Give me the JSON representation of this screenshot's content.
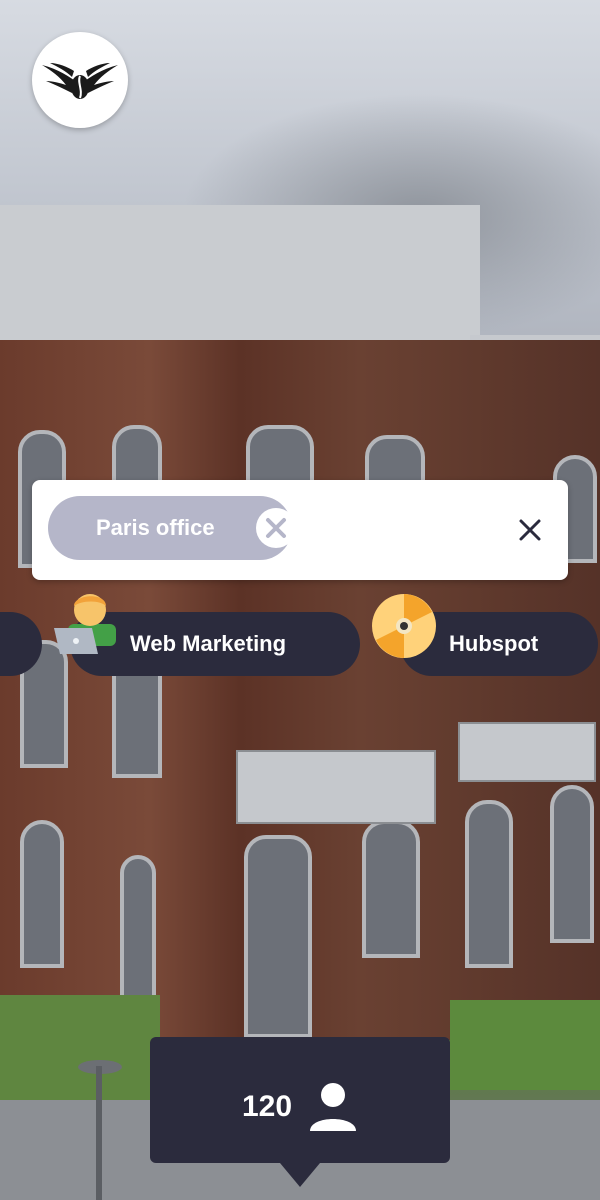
{
  "background": {
    "description_icon": "building-photo"
  },
  "logo": {
    "icon": "winged-coffee-bean-icon"
  },
  "filter": {
    "chip_label": "Paris office",
    "chip_remove_icon": "close-circle-icon",
    "close_icon": "close-icon"
  },
  "tags": [
    {
      "label": "",
      "icon": ""
    },
    {
      "label": "Web Marketing",
      "icon": "person-laptop-emoji"
    },
    {
      "label": "Hubspot",
      "icon": "disc-emoji"
    }
  ],
  "counter": {
    "value": "120",
    "icon": "person-icon"
  },
  "colors": {
    "dark": "#2b2b3d",
    "chip": "#b5b6c9",
    "white": "#ffffff"
  }
}
